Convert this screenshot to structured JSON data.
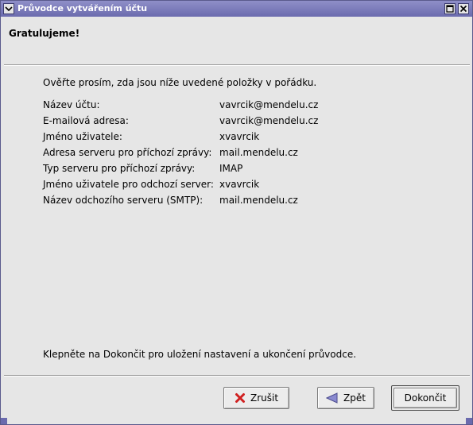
{
  "window": {
    "title": "Průvodce vytvářením účtu"
  },
  "page": {
    "title": "Gratulujeme!",
    "intro": "Ověřte prosím, zda jsou níže uvedené položky v pořádku.",
    "footer_note": "Klepněte na Dokončit pro uložení nastavení a ukončení průvodce."
  },
  "summary": [
    {
      "label": "Název účtu:",
      "value": "vavrcik@mendelu.cz"
    },
    {
      "label": "E-mailová adresa:",
      "value": "vavrcik@mendelu.cz"
    },
    {
      "label": "Jméno uživatele:",
      "value": "xvavrcik"
    },
    {
      "label": "Adresa serveru pro příchozí zprávy:",
      "value": "mail.mendelu.cz"
    },
    {
      "label": "Typ serveru pro příchozí zprávy:",
      "value": "IMAP"
    },
    {
      "label": "Jméno uživatele pro odchozí server:",
      "value": "xvavrcik"
    },
    {
      "label": "Název odchozího serveru (SMTP):",
      "value": "mail.mendelu.cz"
    }
  ],
  "buttons": {
    "cancel": "Zrušit",
    "back": "Zpět",
    "finish": "Dokončit"
  },
  "colors": {
    "titlebar": "#6b6bae",
    "cancel_icon": "#d02020",
    "back_icon": "#8a8ad0"
  }
}
